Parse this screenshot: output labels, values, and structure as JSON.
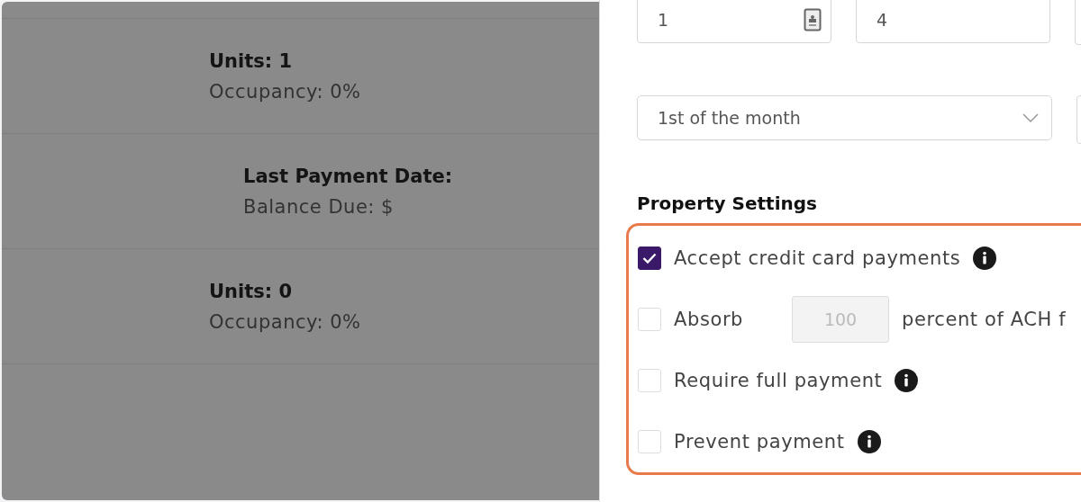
{
  "rooms_list": [
    {
      "kind": "units",
      "title": "Units: 1",
      "detail": "Occupancy: 0%"
    },
    {
      "kind": "payment",
      "title": "Last Payment Date:",
      "detail": "Balance Due: $"
    },
    {
      "kind": "units",
      "title": "Units: 0",
      "detail": "Occupancy: 0%"
    }
  ],
  "form": {
    "number_fields": [
      {
        "kind": "with-icon",
        "value": "1"
      },
      {
        "kind": "plain",
        "value": "4"
      }
    ],
    "due_select": {
      "value": "1st of the month"
    }
  },
  "property_settings": {
    "title": "Property Settings",
    "options": [
      {
        "kind": "checkbox",
        "label": "Accept credit card payments",
        "checked": true,
        "info": true
      },
      {
        "kind": "absorb",
        "label": "Absorb",
        "checked": false,
        "amount": "100",
        "amount_disabled": true,
        "suffix": "percent of ACH f"
      },
      {
        "kind": "checkbox",
        "label": "Require full payment",
        "checked": false,
        "info": true
      },
      {
        "kind": "checkbox",
        "label": "Prevent payment",
        "checked": false,
        "info": true
      }
    ]
  }
}
